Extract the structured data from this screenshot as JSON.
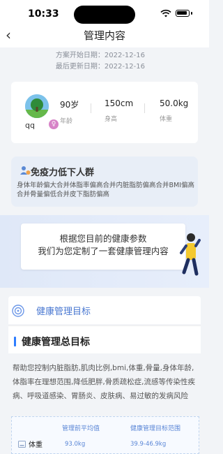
{
  "status_bar": {
    "time": "10:33"
  },
  "nav": {
    "back_icon": "chevron-left-icon",
    "title": "管理内容"
  },
  "dates": {
    "start": "方案开始日期：2022-12-16",
    "updated": "最后更新日期：2022-12-16"
  },
  "profile": {
    "username": "qq",
    "gender_icon": "♀",
    "stats": [
      {
        "value": "90岁",
        "label": "年龄"
      },
      {
        "value": "150cm",
        "label": "身高"
      },
      {
        "value": "50.0kg",
        "label": "体重"
      }
    ]
  },
  "immune": {
    "title": "免疫力低下人群",
    "desc": "身体年龄偏大合并体脂率偏高合并内脏脂肪偏高合并BMI偏高合并骨量偏低合并皮下脂肪偏高"
  },
  "banner": {
    "line1": "根据您目前的健康参数",
    "line2": "我们为您定制了一套健康管理内容"
  },
  "goals": {
    "section_title": "健康管理目标",
    "overall_title": "健康管理总目标",
    "desc": "帮助您控制内脏脂肪,肌肉比例,bmi,体重,骨量,身体年龄,体脂率在理想范围,降低肥胖,骨质疏松症,流感等传染性疾病、呼吸道感染、胃肠炎、皮肤病、易过敏的发病风险",
    "table": {
      "headers": [
        "管理前平均值",
        "健康管理目标范围"
      ],
      "rows": [
        {
          "name": "体重",
          "before": "93.0kg",
          "target": "39.9-46.9kg"
        }
      ]
    }
  },
  "colors": {
    "accent": "#4a78d1",
    "primary_blue": "#2d7dff",
    "gender_pink": "#d783c7"
  }
}
